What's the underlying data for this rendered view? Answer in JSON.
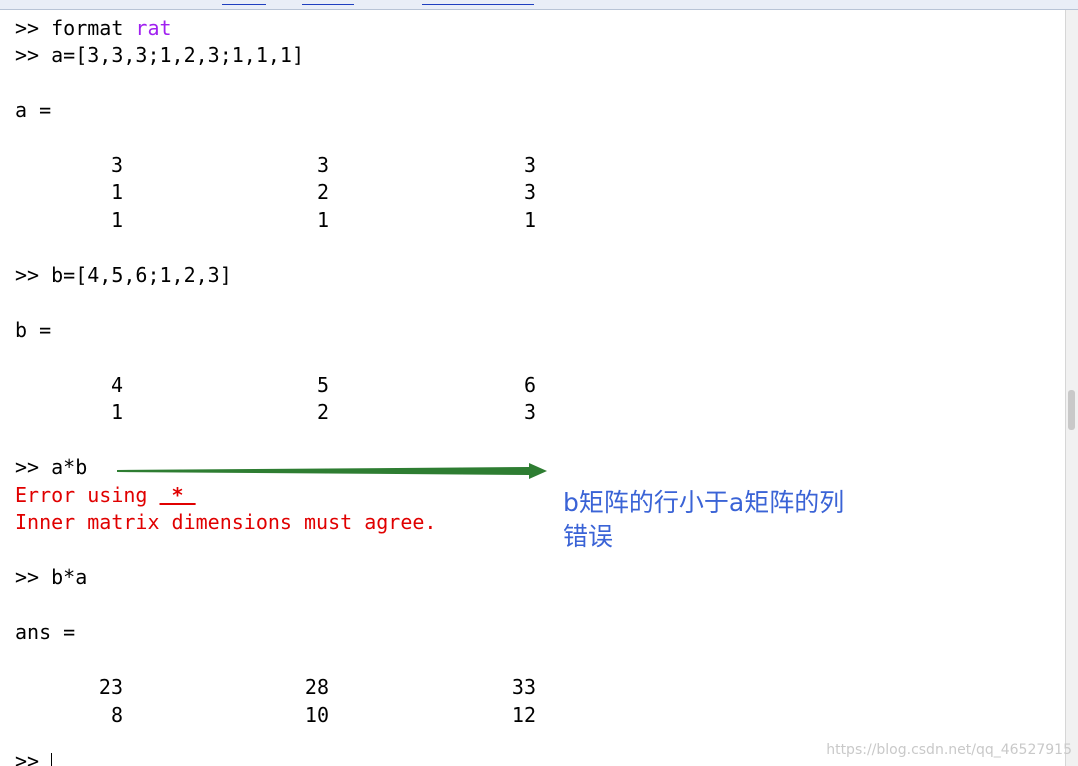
{
  "console": {
    "lines": [
      {
        "prompt": ">> ",
        "text": "format ",
        "keyword": "rat"
      },
      {
        "prompt": ">> ",
        "text": "a=[3,3,3;1,2,3;1,1,1]"
      },
      {
        "text": "a ="
      },
      {
        "prompt": ">> ",
        "text": "b=[4,5,6;1,2,3]"
      },
      {
        "text": "b ="
      },
      {
        "prompt": ">> ",
        "text": "a*b"
      },
      {
        "prompt": ">> ",
        "text": "b*a"
      },
      {
        "text": "ans ="
      },
      {
        "prompt": ">> ",
        "text": ""
      }
    ],
    "matrix_a": [
      [
        "3",
        "3",
        "3"
      ],
      [
        "1",
        "2",
        "3"
      ],
      [
        "1",
        "1",
        "1"
      ]
    ],
    "matrix_b": [
      [
        "4",
        "5",
        "6"
      ],
      [
        "1",
        "2",
        "3"
      ]
    ],
    "matrix_ans": [
      [
        "23",
        "28",
        "33"
      ],
      [
        "8",
        "10",
        "12"
      ]
    ],
    "error": {
      "prefix": "Error using ",
      "link": " * ",
      "message": "Inner matrix dimensions must agree."
    }
  },
  "annotation": {
    "text": "b矩阵的行小于a矩阵的列\n错误",
    "color": "#3a63d6",
    "arrow_color": "#2e7d32"
  },
  "colors": {
    "keyword": "#a020f0",
    "error": "#e00000"
  },
  "watermark": "https://blog.csdn.net/qq_46527915"
}
